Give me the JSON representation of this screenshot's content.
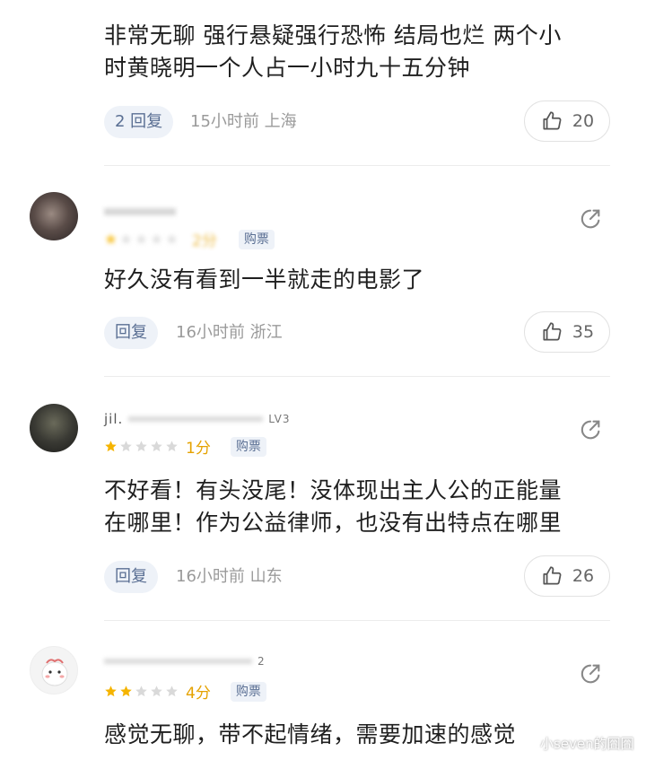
{
  "comments": [
    {
      "text_line1": "非常无聊 强行悬疑强行恐怖 结局也烂 两个小",
      "text_line2": "时黄晓明一个人占一小时九十五分钟",
      "reply_label": "2 回复",
      "time": "15小时前",
      "location": "上海",
      "likes": "20"
    },
    {
      "score": "2分",
      "stars": 1,
      "tag": "购票",
      "text_line1": "好久没有看到一半就走的电影了",
      "reply_label": "回复",
      "time": "16小时前",
      "location": "浙江",
      "likes": "35"
    },
    {
      "username_prefix": "jil.",
      "username_suffix": "LV3",
      "score": "1分",
      "stars": 1,
      "tag": "购票",
      "text_line1": "不好看！有头没尾！没体现出主人公的正能量",
      "text_line2": "在哪里！作为公益律师，也没有出特点在哪里",
      "reply_label": "回复",
      "time": "16小时前",
      "location": "山东",
      "likes": "26"
    },
    {
      "username_suffix": "2",
      "score": "4分",
      "stars": 2,
      "tag": "购票",
      "text_line1": "感觉无聊，带不起情绪，需要加速的感觉"
    }
  ],
  "watermark": "小seven的囧囧",
  "colors": {
    "star_on": "#f5b400",
    "star_off": "#d9d9d9",
    "accent": "#5a6f93"
  }
}
